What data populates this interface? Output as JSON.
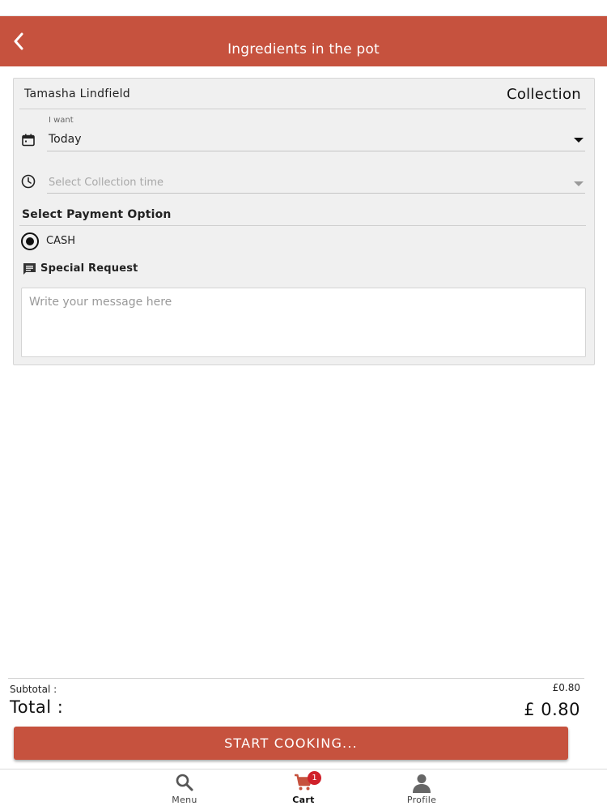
{
  "header": {
    "title": "Ingredients in the pot"
  },
  "order": {
    "customer_name": "Tamasha Lindfield",
    "mode": "Collection",
    "date_label": "I want",
    "date_value": "Today",
    "time_placeholder": "Select Collection time",
    "payment_heading": "Select Payment Option",
    "payment_option": "CASH",
    "special_request_label": "Special Request",
    "message_placeholder": "Write your message here"
  },
  "totals": {
    "subtotal_label": "Subtotal :",
    "subtotal_value": "£0.80",
    "total_label": "Total :",
    "total_value": "£ 0.80"
  },
  "actions": {
    "start_cooking": "START COOKING..."
  },
  "nav": {
    "items": [
      {
        "label": "Menu",
        "icon": "search-icon"
      },
      {
        "label": "Cart",
        "icon": "cart-icon",
        "badge": "1",
        "active": true
      },
      {
        "label": "Profile",
        "icon": "person-icon"
      }
    ]
  },
  "colors": {
    "brand": "#c6523e",
    "badge": "#d0202a"
  }
}
